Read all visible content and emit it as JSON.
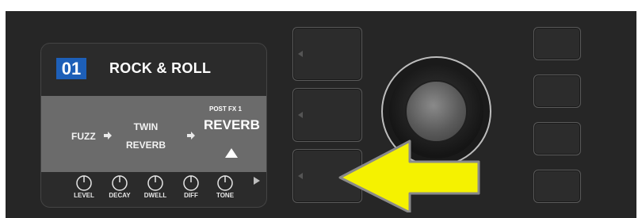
{
  "display": {
    "preset_number": "01",
    "preset_name": "ROCK & ROLL",
    "chain": {
      "item1": "FUZZ",
      "item2_line1": "TWIN",
      "item2_line2": "REVERB",
      "post_fx_label": "POST FX 1",
      "selected_item": "REVERB"
    },
    "knobs": [
      {
        "label": "LEVEL"
      },
      {
        "label": "DECAY"
      },
      {
        "label": "DWELL"
      },
      {
        "label": "DIFF"
      },
      {
        "label": "TONE"
      }
    ]
  },
  "icons": {
    "chain_arrow": "right-arrow-icon",
    "selection_marker": "up-triangle-icon",
    "page_next": "play-right-icon",
    "callout": "yellow-left-arrow-icon"
  },
  "colors": {
    "panel": "#262626",
    "preset_badge": "#1d5fb8",
    "callout_arrow": "#f5f200"
  }
}
